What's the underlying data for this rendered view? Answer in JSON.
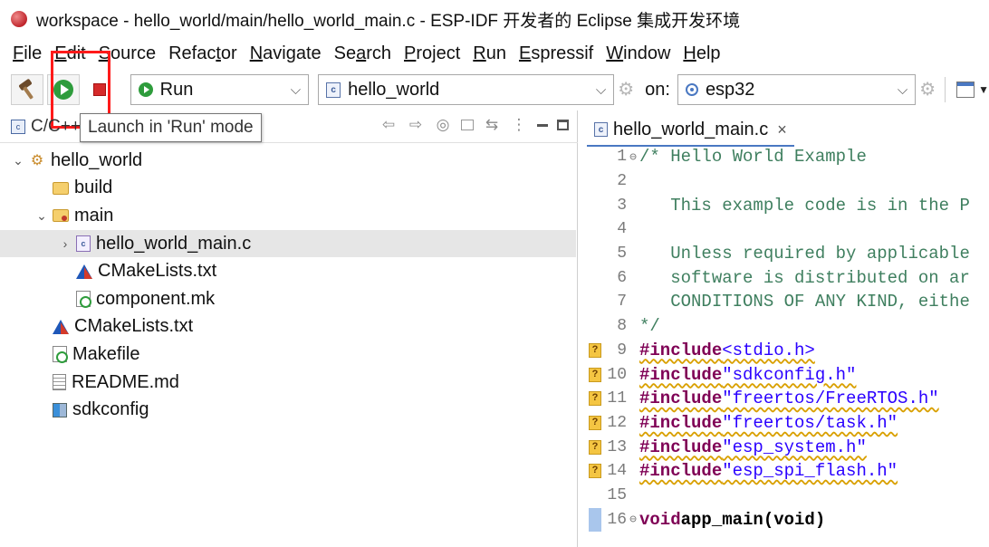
{
  "window": {
    "title": "workspace - hello_world/main/hello_world_main.c - ESP-IDF 开发者的 Eclipse 集成开发环境"
  },
  "menu": [
    {
      "label": "File",
      "mnemonic": "F"
    },
    {
      "label": "Edit",
      "mnemonic": "E"
    },
    {
      "label": "Source",
      "mnemonic": "S"
    },
    {
      "label": "Refactor",
      "mnemonic": "t"
    },
    {
      "label": "Navigate",
      "mnemonic": "N"
    },
    {
      "label": "Search",
      "mnemonic": "a"
    },
    {
      "label": "Project",
      "mnemonic": "P"
    },
    {
      "label": "Run",
      "mnemonic": "R"
    },
    {
      "label": "Espressif",
      "mnemonic": "E"
    },
    {
      "label": "Window",
      "mnemonic": "W"
    },
    {
      "label": "Help",
      "mnemonic": "H"
    }
  ],
  "toolbar": {
    "launch_mode": "Run",
    "launch_config": "hello_world",
    "on_label": "on:",
    "target": "esp32"
  },
  "tooltip": "Launch in 'Run' mode",
  "project_explorer": {
    "title": "C/C++",
    "tree": [
      {
        "label": "hello_world",
        "depth": 0,
        "twisty": "v",
        "icon": "project-icon"
      },
      {
        "label": "build",
        "depth": 1,
        "twisty": "",
        "icon": "folder-icon"
      },
      {
        "label": "main",
        "depth": 1,
        "twisty": "v",
        "icon": "source-folder-icon"
      },
      {
        "label": "hello_world_main.c",
        "depth": 2,
        "twisty": ">",
        "icon": "c-file-icon",
        "selected": true
      },
      {
        "label": "CMakeLists.txt",
        "depth": 2,
        "twisty": "",
        "icon": "cmake-icon"
      },
      {
        "label": "component.mk",
        "depth": 2,
        "twisty": "",
        "icon": "makefile-icon"
      },
      {
        "label": "CMakeLists.txt",
        "depth": 1,
        "twisty": "",
        "icon": "cmake-icon"
      },
      {
        "label": "Makefile",
        "depth": 1,
        "twisty": "",
        "icon": "makefile-icon"
      },
      {
        "label": "README.md",
        "depth": 1,
        "twisty": "",
        "icon": "document-icon"
      },
      {
        "label": "sdkconfig",
        "depth": 1,
        "twisty": "",
        "icon": "config-icon"
      }
    ]
  },
  "editor": {
    "tab_label": "hello_world_main.c",
    "close_glyph": "×",
    "lines": [
      {
        "n": "1",
        "fold": "⊖",
        "mark": "",
        "text": "/* Hello World Example",
        "kind": "comment"
      },
      {
        "n": "2",
        "fold": "",
        "mark": "",
        "text": "",
        "kind": "comment"
      },
      {
        "n": "3",
        "fold": "",
        "mark": "",
        "text": "   This example code is in the P",
        "kind": "comment"
      },
      {
        "n": "4",
        "fold": "",
        "mark": "",
        "text": "",
        "kind": "comment"
      },
      {
        "n": "5",
        "fold": "",
        "mark": "",
        "text": "   Unless required by applicable",
        "kind": "comment"
      },
      {
        "n": "6",
        "fold": "",
        "mark": "",
        "text": "   software is distributed on ar",
        "kind": "comment"
      },
      {
        "n": "7",
        "fold": "",
        "mark": "",
        "text": "   CONDITIONS OF ANY KIND, eithe",
        "kind": "comment"
      },
      {
        "n": "8",
        "fold": "",
        "mark": "",
        "text": "*/",
        "kind": "comment"
      },
      {
        "n": "9",
        "fold": "",
        "mark": "?",
        "text": "<stdio.h>",
        "kind": "include"
      },
      {
        "n": "10",
        "fold": "",
        "mark": "?",
        "text": "\"sdkconfig.h\"",
        "kind": "include"
      },
      {
        "n": "11",
        "fold": "",
        "mark": "?",
        "text": "\"freertos/FreeRTOS.h\"",
        "kind": "include"
      },
      {
        "n": "12",
        "fold": "",
        "mark": "?",
        "text": "\"freertos/task.h\"",
        "kind": "include"
      },
      {
        "n": "13",
        "fold": "",
        "mark": "?",
        "text": "\"esp_system.h\"",
        "kind": "include"
      },
      {
        "n": "14",
        "fold": "",
        "mark": "?",
        "text": "\"esp_spi_flash.h\"",
        "kind": "include"
      },
      {
        "n": "15",
        "fold": "",
        "mark": "",
        "text": "",
        "kind": "plain"
      },
      {
        "n": "16",
        "fold": "⊖",
        "mark": "bar",
        "text": "app_main(void)",
        "kind": "func"
      }
    ],
    "include_keyword": "#include",
    "void_keyword": "void"
  }
}
